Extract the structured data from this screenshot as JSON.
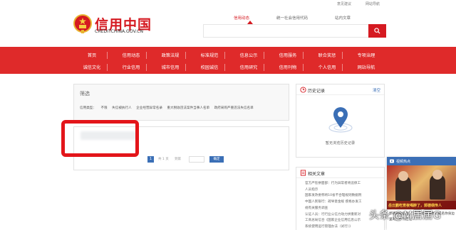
{
  "topbar": {
    "link1": "意见建议",
    "link2": "网站导航"
  },
  "logo": {
    "title": "信用中国",
    "subtitle": "CREDITCHINA.GOV.CN"
  },
  "search": {
    "tabs": [
      "信用动态",
      "统一社会信用代码",
      "站内文章"
    ],
    "active_tab": 0,
    "placeholder": ""
  },
  "nav": {
    "row1": [
      "首页",
      "信用动态",
      "政策法规",
      "标准规范",
      "信息公示",
      "信用服务",
      "联合奖惩",
      "专项治理"
    ],
    "row2": [
      "诚信文化",
      "行业信用",
      "城市信用",
      "校园诚信",
      "信用研究",
      "信用刊物",
      "个人信用",
      "网站导航"
    ]
  },
  "filter": {
    "title": "筛选",
    "label": "信用类型：",
    "options": [
      "不限",
      "失信被执行人",
      "企业经营异常名录",
      "重大税收违法案件当事人名单",
      "政府采购严重违法失信名单"
    ]
  },
  "pager": {
    "current": "1",
    "total_text": "共 1 页",
    "goto_text": "到第",
    "go_label": "确定"
  },
  "history": {
    "title": "历史记录",
    "clear": "清空",
    "empty_text": "暂无浏览历史记录"
  },
  "related": {
    "title": "相关文章",
    "items": [
      "官方严惩拼面部：行为异常者将追保工",
      "人员指示",
      "国家发改委称将10省不合理规则数据例",
      "中国人民银行：疏导意金规 疾格办发工",
      "规有关服务调查",
      "认证人员：行行业公信力动力拼重新对",
      "工商总局信合《国家企业信用信息公示",
      "系统使用运行管理办法（试行）》"
    ]
  },
  "video": {
    "header": "视频热点",
    "overlay_text": "岳云鹏吃宵夜喝醉了，郭德纲传人",
    "caption": "郭德纲收徒念定了！了结这样你们成名你身边里的，不然后还..."
  },
  "watermark": "头条 @M居居G",
  "colors": {
    "brand_red": "#d51a21",
    "nav_red": "#df2a2a",
    "link_blue": "#3b6fb6",
    "highlight_rect": "#e3151a"
  },
  "icons": {
    "search": "search-icon",
    "emblem": "national-emblem-icon",
    "history": "clock-icon",
    "related": "document-icon",
    "location": "location-pin-icon",
    "video": "video-icon"
  }
}
